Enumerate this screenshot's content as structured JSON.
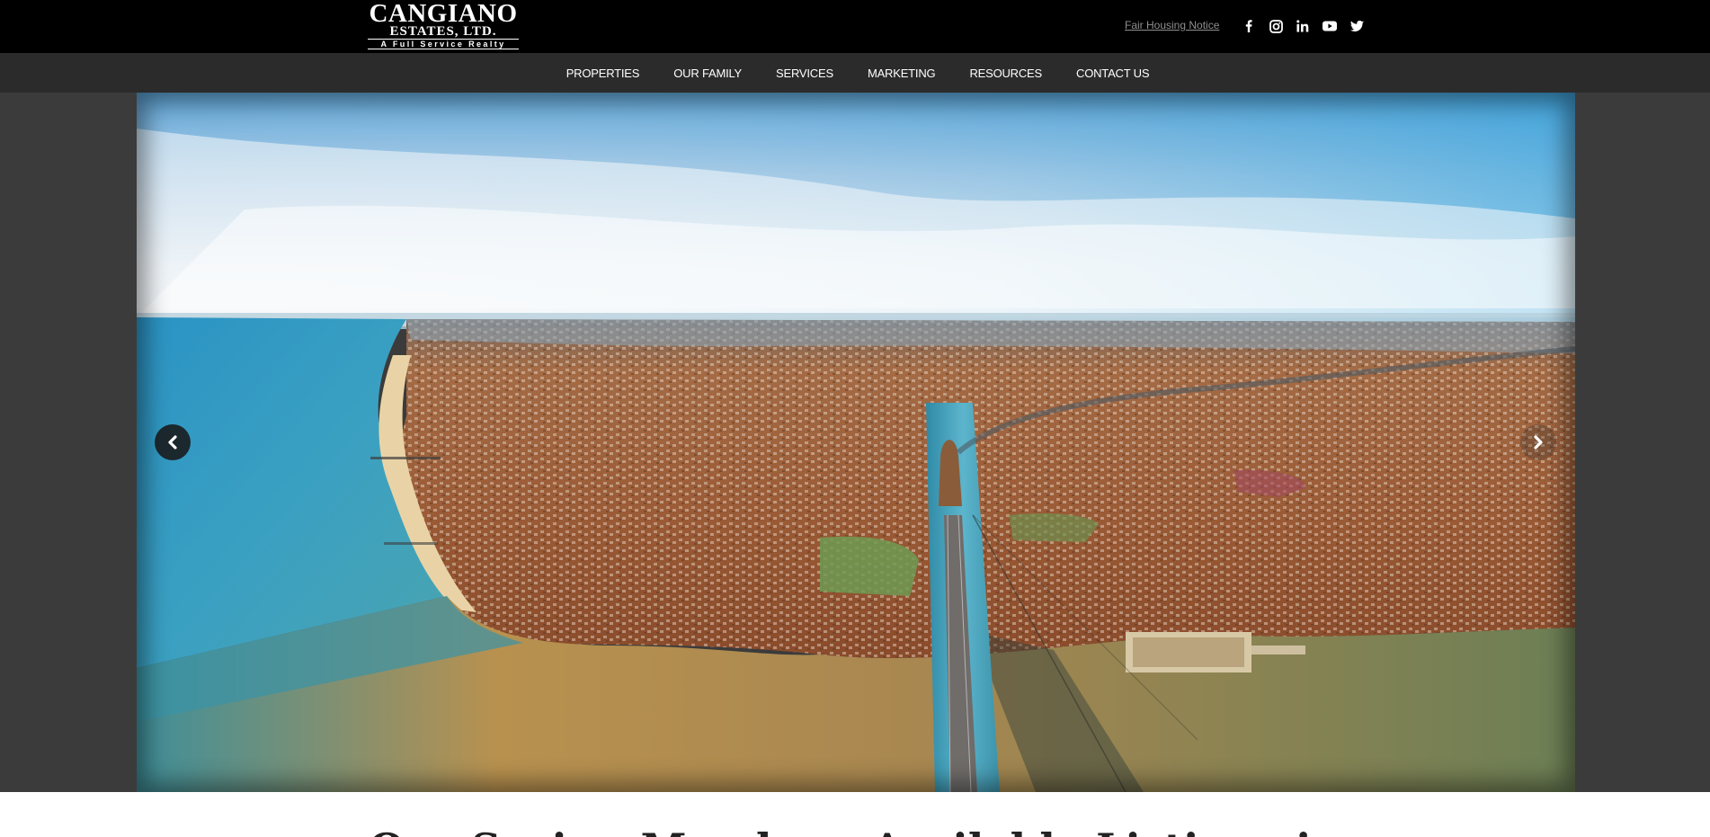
{
  "brand": {
    "line1": "CANGIANO",
    "line2": "ESTATES, LTD.",
    "line3": "A Full Service Realty"
  },
  "header": {
    "fair_housing_link": "Fair Housing Notice",
    "social_icons": [
      "facebook-icon",
      "instagram-icon",
      "linkedin-icon",
      "youtube-icon",
      "twitter-icon"
    ]
  },
  "nav": {
    "items": [
      "PROPERTIES",
      "OUR FAMILY",
      "SERVICES",
      "MARKETING",
      "RESOURCES",
      "CONTACT US"
    ]
  },
  "hero": {
    "arrow_prev_icon": "chevron-left-icon",
    "arrow_next_icon": "chevron-right-icon"
  },
  "main": {
    "section_heading": "Our Saving Members Available Listings in"
  },
  "colors": {
    "topbar": "#000000",
    "navbar": "#2b2b2b",
    "hero_background": "#3b3b3b",
    "bridge": "#4a9fb6",
    "water": "#2e8fb6",
    "land": "#9a5a35"
  }
}
